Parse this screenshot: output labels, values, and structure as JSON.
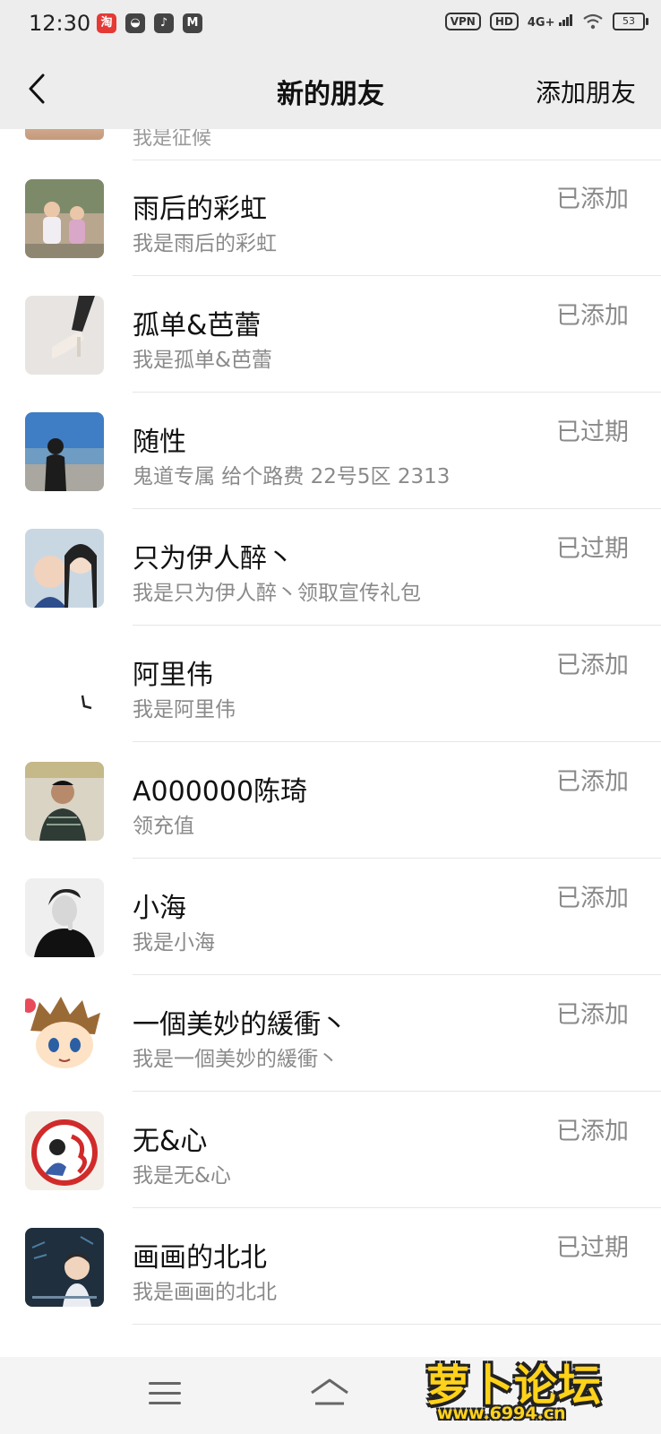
{
  "status_bar": {
    "time": "12:30",
    "app_icons": [
      {
        "name": "taobao-icon",
        "glyph": "淘",
        "color": "#e53935"
      },
      {
        "name": "chat-app-icon",
        "glyph": "◒",
        "color": "#444444"
      },
      {
        "name": "tiktok-icon",
        "glyph": "♪",
        "color": "#444444"
      },
      {
        "name": "mail-icon",
        "glyph": "M",
        "color": "#444444"
      }
    ],
    "vpn": "VPN",
    "hd": "HD",
    "network": "4G+",
    "battery": "53"
  },
  "nav": {
    "title": "新的朋友",
    "action": "添加朋友"
  },
  "partial_top": {
    "message": "我是征候"
  },
  "contacts": [
    {
      "name": "雨后的彩虹",
      "message": "我是雨后的彩虹",
      "status": "已添加",
      "avatar": "photo-family"
    },
    {
      "name": "孤单&芭蕾",
      "message": "我是孤单&芭蕾",
      "status": "已添加",
      "avatar": "photo-heels"
    },
    {
      "name": "随性",
      "message": "鬼道专属 给个路费 22号5区 2313",
      "status": "已过期",
      "avatar": "photo-seaside"
    },
    {
      "name": "只为伊人醉丶",
      "message": "我是只为伊人醉丶领取宣传礼包",
      "status": "已过期",
      "avatar": "photo-selfie"
    },
    {
      "name": "阿里伟",
      "message": "我是阿里伟",
      "status": "已添加",
      "avatar": "photo-white"
    },
    {
      "name": "A000000陈琦",
      "message": "领充值",
      "status": "已添加",
      "avatar": "photo-man"
    },
    {
      "name": "小海",
      "message": "我是小海",
      "status": "已添加",
      "avatar": "photo-bw-portrait"
    },
    {
      "name": "一個美妙的緩衝丶",
      "message": "我是一個美妙的緩衝丶",
      "status": "已添加",
      "avatar": "cartoon-boy"
    },
    {
      "name": "无&心",
      "message": "我是无&心",
      "status": "已添加",
      "avatar": "logo-badge"
    },
    {
      "name": "画画的北北",
      "message": "我是画画的北北",
      "status": "已过期",
      "avatar": "dark-cartoon"
    }
  ],
  "watermark": {
    "title": "萝卜论坛",
    "url": "www.6994.cn"
  },
  "colors": {
    "background": "#ededed",
    "list_bg": "#ffffff",
    "secondary_text": "#8a8a8a"
  }
}
